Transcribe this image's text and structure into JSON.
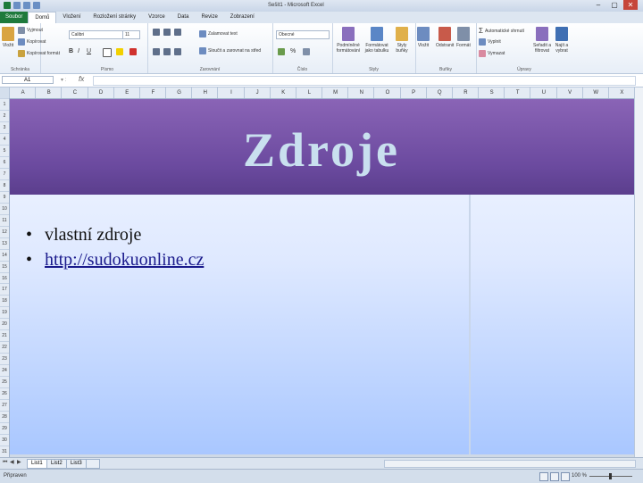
{
  "window": {
    "document_title": "Sešit1 - Microsoft Excel"
  },
  "ribbon_tabs": [
    "Soubor",
    "Domů",
    "Vložení",
    "Rozložení stránky",
    "Vzorce",
    "Data",
    "Revize",
    "Zobrazení"
  ],
  "ribbon": {
    "clipboard": {
      "paste": "Vložit",
      "cut": "Vyjmout",
      "copy": "Kopírovat",
      "format_painter": "Kopírovat formát",
      "name": "Schránka"
    },
    "font": {
      "family": "Calibri",
      "size": "11",
      "name": "Písmo"
    },
    "alignment": {
      "wrap": "Zalamovat text",
      "merge": "Sloučit a zarovnat na střed",
      "name": "Zarovnání"
    },
    "number": {
      "format": "Obecné",
      "name": "Číslo"
    },
    "styles": {
      "conditional": "Podmíněné formátování",
      "table": "Formátovat jako tabulku",
      "cell": "Styly buňky",
      "name": "Styly"
    },
    "cells": {
      "insert": "Vložit",
      "delete": "Odstranit",
      "format": "Formát",
      "name": "Buňky"
    },
    "editing": {
      "autosum": "Automatické shrnutí",
      "fill": "Vyplnit",
      "clear": "Vymazat",
      "sort": "Seřadit a filtrovat",
      "find": "Najít a vybrat",
      "name": "Úpravy"
    }
  },
  "formula_bar": {
    "name_box": "A1",
    "fx": "fx"
  },
  "columns": [
    "A",
    "B",
    "C",
    "D",
    "E",
    "F",
    "G",
    "H",
    "I",
    "J",
    "K",
    "L",
    "M",
    "N",
    "O",
    "P",
    "Q",
    "R",
    "S",
    "T",
    "U",
    "V",
    "W",
    "X"
  ],
  "rows": [
    "1",
    "2",
    "3",
    "4",
    "5",
    "6",
    "7",
    "8",
    "9",
    "10",
    "11",
    "12",
    "13",
    "14",
    "15",
    "16",
    "17",
    "18",
    "19",
    "20",
    "21",
    "22",
    "23",
    "24",
    "25",
    "26",
    "27",
    "28",
    "29",
    "30",
    "31"
  ],
  "slide": {
    "title": "Zdroje",
    "bullets": [
      {
        "marker": "•",
        "text": "vlastní zdroje",
        "link": false
      },
      {
        "marker": "•",
        "text": "http://sudokuonline.cz",
        "link": true
      }
    ]
  },
  "sheet_tabs": [
    "List1",
    "List2",
    "List3"
  ],
  "status": {
    "mode": "Připraven",
    "zoom": "100 %"
  }
}
